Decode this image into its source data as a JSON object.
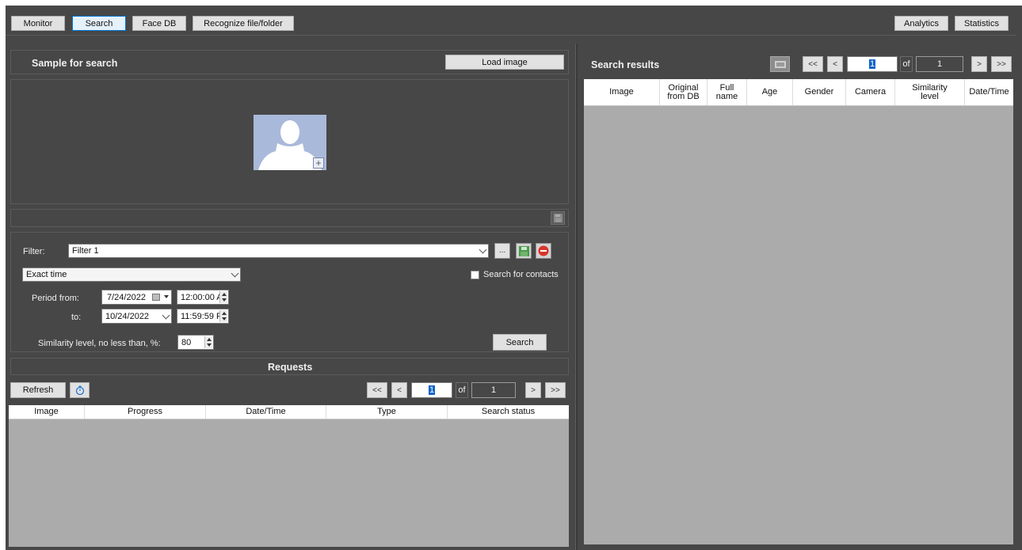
{
  "top_tabs": {
    "monitor": "Monitor",
    "search": "Search",
    "face_db": "Face DB",
    "recognize": "Recognize file/folder",
    "analytics": "Analytics",
    "statistics": "Statistics"
  },
  "sample": {
    "title": "Sample for search",
    "load_image": "Load image"
  },
  "filter": {
    "label": "Filter:",
    "value": "Filter 1",
    "more_button": "...",
    "time_mode": "Exact time",
    "search_contacts": "Search for contacts",
    "period_from_label": "Period from:",
    "from_date": "7/24/2022",
    "from_time": "12:00:00 A",
    "to_label": "to:",
    "to_date": "10/24/2022",
    "to_time": "11:59:59 P",
    "similarity_label": "Similarity level, no less than, %:",
    "similarity_value": "80",
    "search_button": "Search"
  },
  "requests": {
    "title": "Requests",
    "refresh": "Refresh",
    "pager": {
      "first": "<<",
      "prev": "<",
      "page": "1",
      "of": "of",
      "total": "1",
      "next": ">",
      "last": ">>"
    },
    "columns": [
      "Image",
      "Progress",
      "Date/Time",
      "Type",
      "Search status"
    ]
  },
  "results": {
    "title": "Search results",
    "pager": {
      "first": "<<",
      "prev": "<",
      "page": "1",
      "of": "of",
      "total": "1",
      "next": ">",
      "last": ">>"
    },
    "columns": [
      {
        "l1": "Image",
        "l2": ""
      },
      {
        "l1": "Original",
        "l2": "from DB"
      },
      {
        "l1": "Full",
        "l2": "name"
      },
      {
        "l1": "Age",
        "l2": ""
      },
      {
        "l1": "Gender",
        "l2": ""
      },
      {
        "l1": "Camera",
        "l2": ""
      },
      {
        "l1": "Similarity",
        "l2": "level"
      },
      {
        "l1": "Date/Time",
        "l2": ""
      }
    ]
  },
  "colors": {
    "background": "#474747",
    "grid_body": "#ababab",
    "active_tab_border": "#0078d7",
    "delete_red": "#d9342b"
  }
}
